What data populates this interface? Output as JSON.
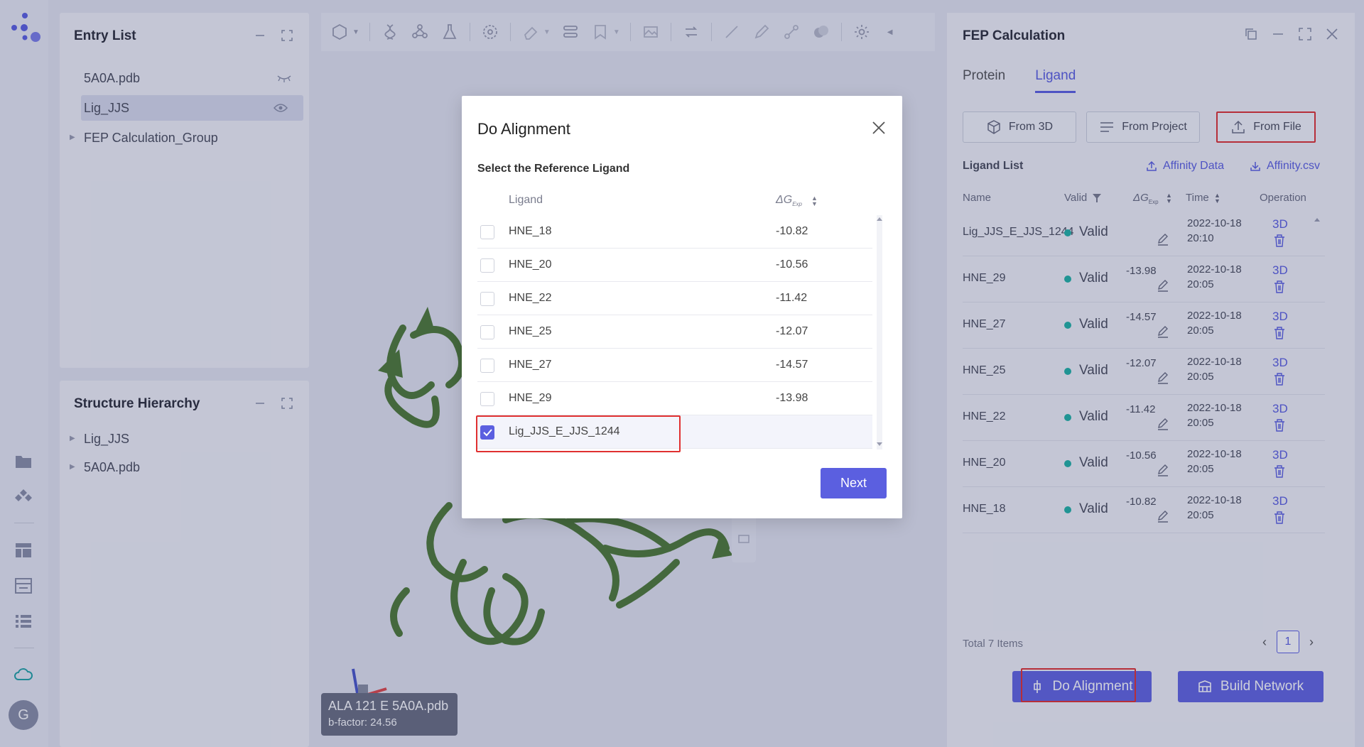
{
  "rail": {
    "avatar_letter": "G"
  },
  "entry_list": {
    "title": "Entry List",
    "items": [
      {
        "label": "5A0A.pdb"
      },
      {
        "label": "Lig_JJS"
      },
      {
        "label": "FEP Calculation_Group"
      }
    ]
  },
  "structure_hierarchy": {
    "title": "Structure Hierarchy",
    "items": [
      {
        "label": "Lig_JJS"
      },
      {
        "label": "5A0A.pdb"
      }
    ]
  },
  "residue_info": {
    "line1": "ALA 121 E 5A0A.pdb",
    "line2": "b-factor: 24.56"
  },
  "fep": {
    "title": "FEP Calculation",
    "tabs": [
      "Protein",
      "Ligand"
    ],
    "active_tab": "Ligand",
    "buttons": {
      "from_3d": "From 3D",
      "from_project": "From Project",
      "from_file": "From File"
    },
    "ligand_list_label": "Ligand List",
    "affinity_data": "Affinity Data",
    "affinity_csv": "Affinity.csv",
    "columns": {
      "name": "Name",
      "valid": "Valid",
      "dg": "ΔG",
      "dg_sub": "Exp",
      "time": "Time",
      "operation": "Operation"
    },
    "rows": [
      {
        "name": "Lig_JJS_E_JJS_1244",
        "valid": "Valid",
        "dg": "",
        "date": "2022-10-18",
        "clock": "20:10",
        "op": "3D"
      },
      {
        "name": "HNE_29",
        "valid": "Valid",
        "dg": "-13.98",
        "date": "2022-10-18",
        "clock": "20:05",
        "op": "3D"
      },
      {
        "name": "HNE_27",
        "valid": "Valid",
        "dg": "-14.57",
        "date": "2022-10-18",
        "clock": "20:05",
        "op": "3D"
      },
      {
        "name": "HNE_25",
        "valid": "Valid",
        "dg": "-12.07",
        "date": "2022-10-18",
        "clock": "20:05",
        "op": "3D"
      },
      {
        "name": "HNE_22",
        "valid": "Valid",
        "dg": "-11.42",
        "date": "2022-10-18",
        "clock": "20:05",
        "op": "3D"
      },
      {
        "name": "HNE_20",
        "valid": "Valid",
        "dg": "-10.56",
        "date": "2022-10-18",
        "clock": "20:05",
        "op": "3D"
      },
      {
        "name": "HNE_18",
        "valid": "Valid",
        "dg": "-10.82",
        "date": "2022-10-18",
        "clock": "20:05",
        "op": "3D"
      }
    ],
    "total": "Total 7 Items",
    "page": "1",
    "do_alignment": "Do Alignment",
    "build_network": "Build Network"
  },
  "modal": {
    "title": "Do Alignment",
    "subtitle": "Select the Reference Ligand",
    "col_ligand": "Ligand",
    "col_dg": "ΔG",
    "col_dg_sub": "Exp",
    "rows": [
      {
        "name": "HNE_18",
        "dg": "-10.82",
        "checked": false
      },
      {
        "name": "HNE_20",
        "dg": "-10.56",
        "checked": false
      },
      {
        "name": "HNE_22",
        "dg": "-11.42",
        "checked": false
      },
      {
        "name": "HNE_25",
        "dg": "-12.07",
        "checked": false
      },
      {
        "name": "HNE_27",
        "dg": "-14.57",
        "checked": false
      },
      {
        "name": "HNE_29",
        "dg": "-13.98",
        "checked": false
      },
      {
        "name": "Lig_JJS_E_JJS_1244",
        "dg": "",
        "checked": true
      }
    ],
    "next": "Next"
  },
  "colors": {
    "accent": "#5b5fe0",
    "valid_dot": "#21b3a4",
    "highlight": "#e03030",
    "protein": "#4f7a35"
  }
}
